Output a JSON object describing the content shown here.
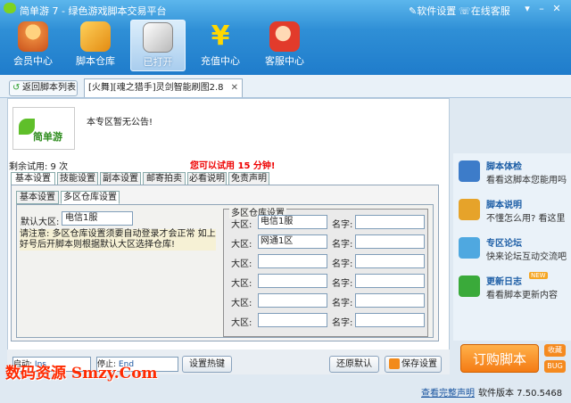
{
  "window": {
    "title": "简单游  7 - 绿色游戏脚本交易平台",
    "software_settings": "软件设置",
    "online_service": "在线客服"
  },
  "nav": [
    {
      "label": "会员中心",
      "icon": "member-icon"
    },
    {
      "label": "脚本仓库",
      "icon": "warehouse-icon"
    },
    {
      "label": "已打开",
      "icon": "opened-icon"
    },
    {
      "label": "充值中心",
      "icon": "yen-icon"
    },
    {
      "label": "客服中心",
      "icon": "service-icon"
    }
  ],
  "back_button": "返回脚本列表",
  "doc_tab": "[火舞][魂之猎手]灵剑智能刷图2.8",
  "logo_text": "简单游",
  "notice": "本专区暂无公告!",
  "trial": {
    "remaining": "剩余试用: 9 次",
    "warning": "您可以试用 15 分钟!"
  },
  "tabs_main": [
    "基本设置",
    "技能设置",
    "副本设置",
    "邮寄拍卖",
    "必看说明",
    "免责声明"
  ],
  "tabs_sub": [
    "基本设置",
    "多区仓库设置"
  ],
  "default_region": {
    "label": "默认大区:",
    "value": "电信1服"
  },
  "note": "请注意: 多区仓库设置须要自动登录才会正常 如上好号后开脚本则根据默认大区选择仓库!",
  "warehouse": {
    "title": "多区仓库设置",
    "region_label": "大区:",
    "name_label": "名字:",
    "rows": [
      {
        "region": "电信1服",
        "name": ""
      },
      {
        "region": "网通1区",
        "name": ""
      },
      {
        "region": "",
        "name": ""
      },
      {
        "region": "",
        "name": ""
      },
      {
        "region": "",
        "name": ""
      },
      {
        "region": "",
        "name": ""
      }
    ]
  },
  "bottom": {
    "start_label": "启动:",
    "start_value": "Ins",
    "stop_label": "停止:",
    "stop_value": "End",
    "set_hotkey": "设置热键",
    "restore": "还原默认",
    "save": "保存设置"
  },
  "sidebar": [
    {
      "title": "脚本体检",
      "desc": "看看这脚本您能用吗",
      "icon": "checkup-icon"
    },
    {
      "title": "脚本说明",
      "desc": "不懂怎么用? 看这里",
      "icon": "manual-icon"
    },
    {
      "title": "专区论坛",
      "desc": "快来论坛互动交流吧",
      "icon": "forum-icon"
    },
    {
      "title": "更新日志",
      "desc": "看看脚本更新内容",
      "icon": "log-icon",
      "badge": "NEW"
    }
  ],
  "buy": "订购脚本",
  "fav": "收藏",
  "bug": "BUG",
  "footer": {
    "statement": "查看完整声明",
    "version": "软件版本 7.50.5468"
  },
  "watermark": "数码资源 Smzy.Com",
  "colors": {
    "accent": "#2f8fd6",
    "warning": "#ee0000",
    "buy": "#f47b14"
  }
}
